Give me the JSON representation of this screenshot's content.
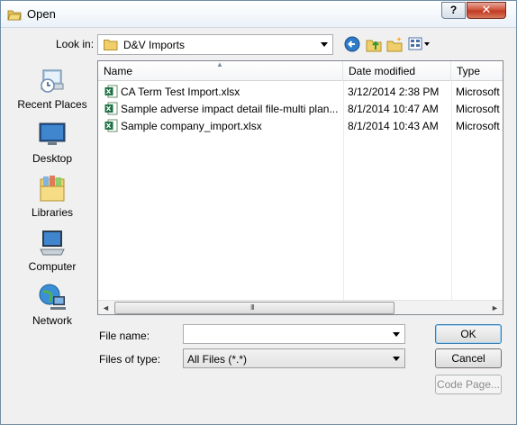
{
  "window": {
    "title": "Open"
  },
  "titlebar": {
    "help_glyph": "?",
    "close_glyph": "✕"
  },
  "lookin": {
    "label": "Look in:",
    "value": "D&V Imports"
  },
  "places": [
    {
      "label": "Recent Places",
      "icon": "recent-places-icon"
    },
    {
      "label": "Desktop",
      "icon": "desktop-icon"
    },
    {
      "label": "Libraries",
      "icon": "libraries-icon"
    },
    {
      "label": "Computer",
      "icon": "computer-icon"
    },
    {
      "label": "Network",
      "icon": "network-icon"
    }
  ],
  "columns": {
    "name": "Name",
    "date": "Date modified",
    "type": "Type"
  },
  "files": [
    {
      "name": "CA Term Test Import.xlsx",
      "date": "3/12/2014 2:38 PM",
      "type": "Microsoft"
    },
    {
      "name": "Sample adverse impact detail file-multi plan...",
      "date": "8/1/2014 10:47 AM",
      "type": "Microsoft"
    },
    {
      "name": "Sample company_import.xlsx",
      "date": "8/1/2014 10:43 AM",
      "type": "Microsoft"
    }
  ],
  "scroll": {
    "left": "◄",
    "right": "►",
    "grip": "III"
  },
  "form": {
    "file_name_label": "File name:",
    "file_name_value": "",
    "files_of_type_label": "Files of type:",
    "files_of_type_value": "All Files (*.*)"
  },
  "buttons": {
    "ok": "OK",
    "cancel": "Cancel",
    "code_page": "Code Page..."
  },
  "colors": {
    "accent": "#3c7fb1",
    "close_red": "#c23a23",
    "excel_green": "#1e7145"
  }
}
